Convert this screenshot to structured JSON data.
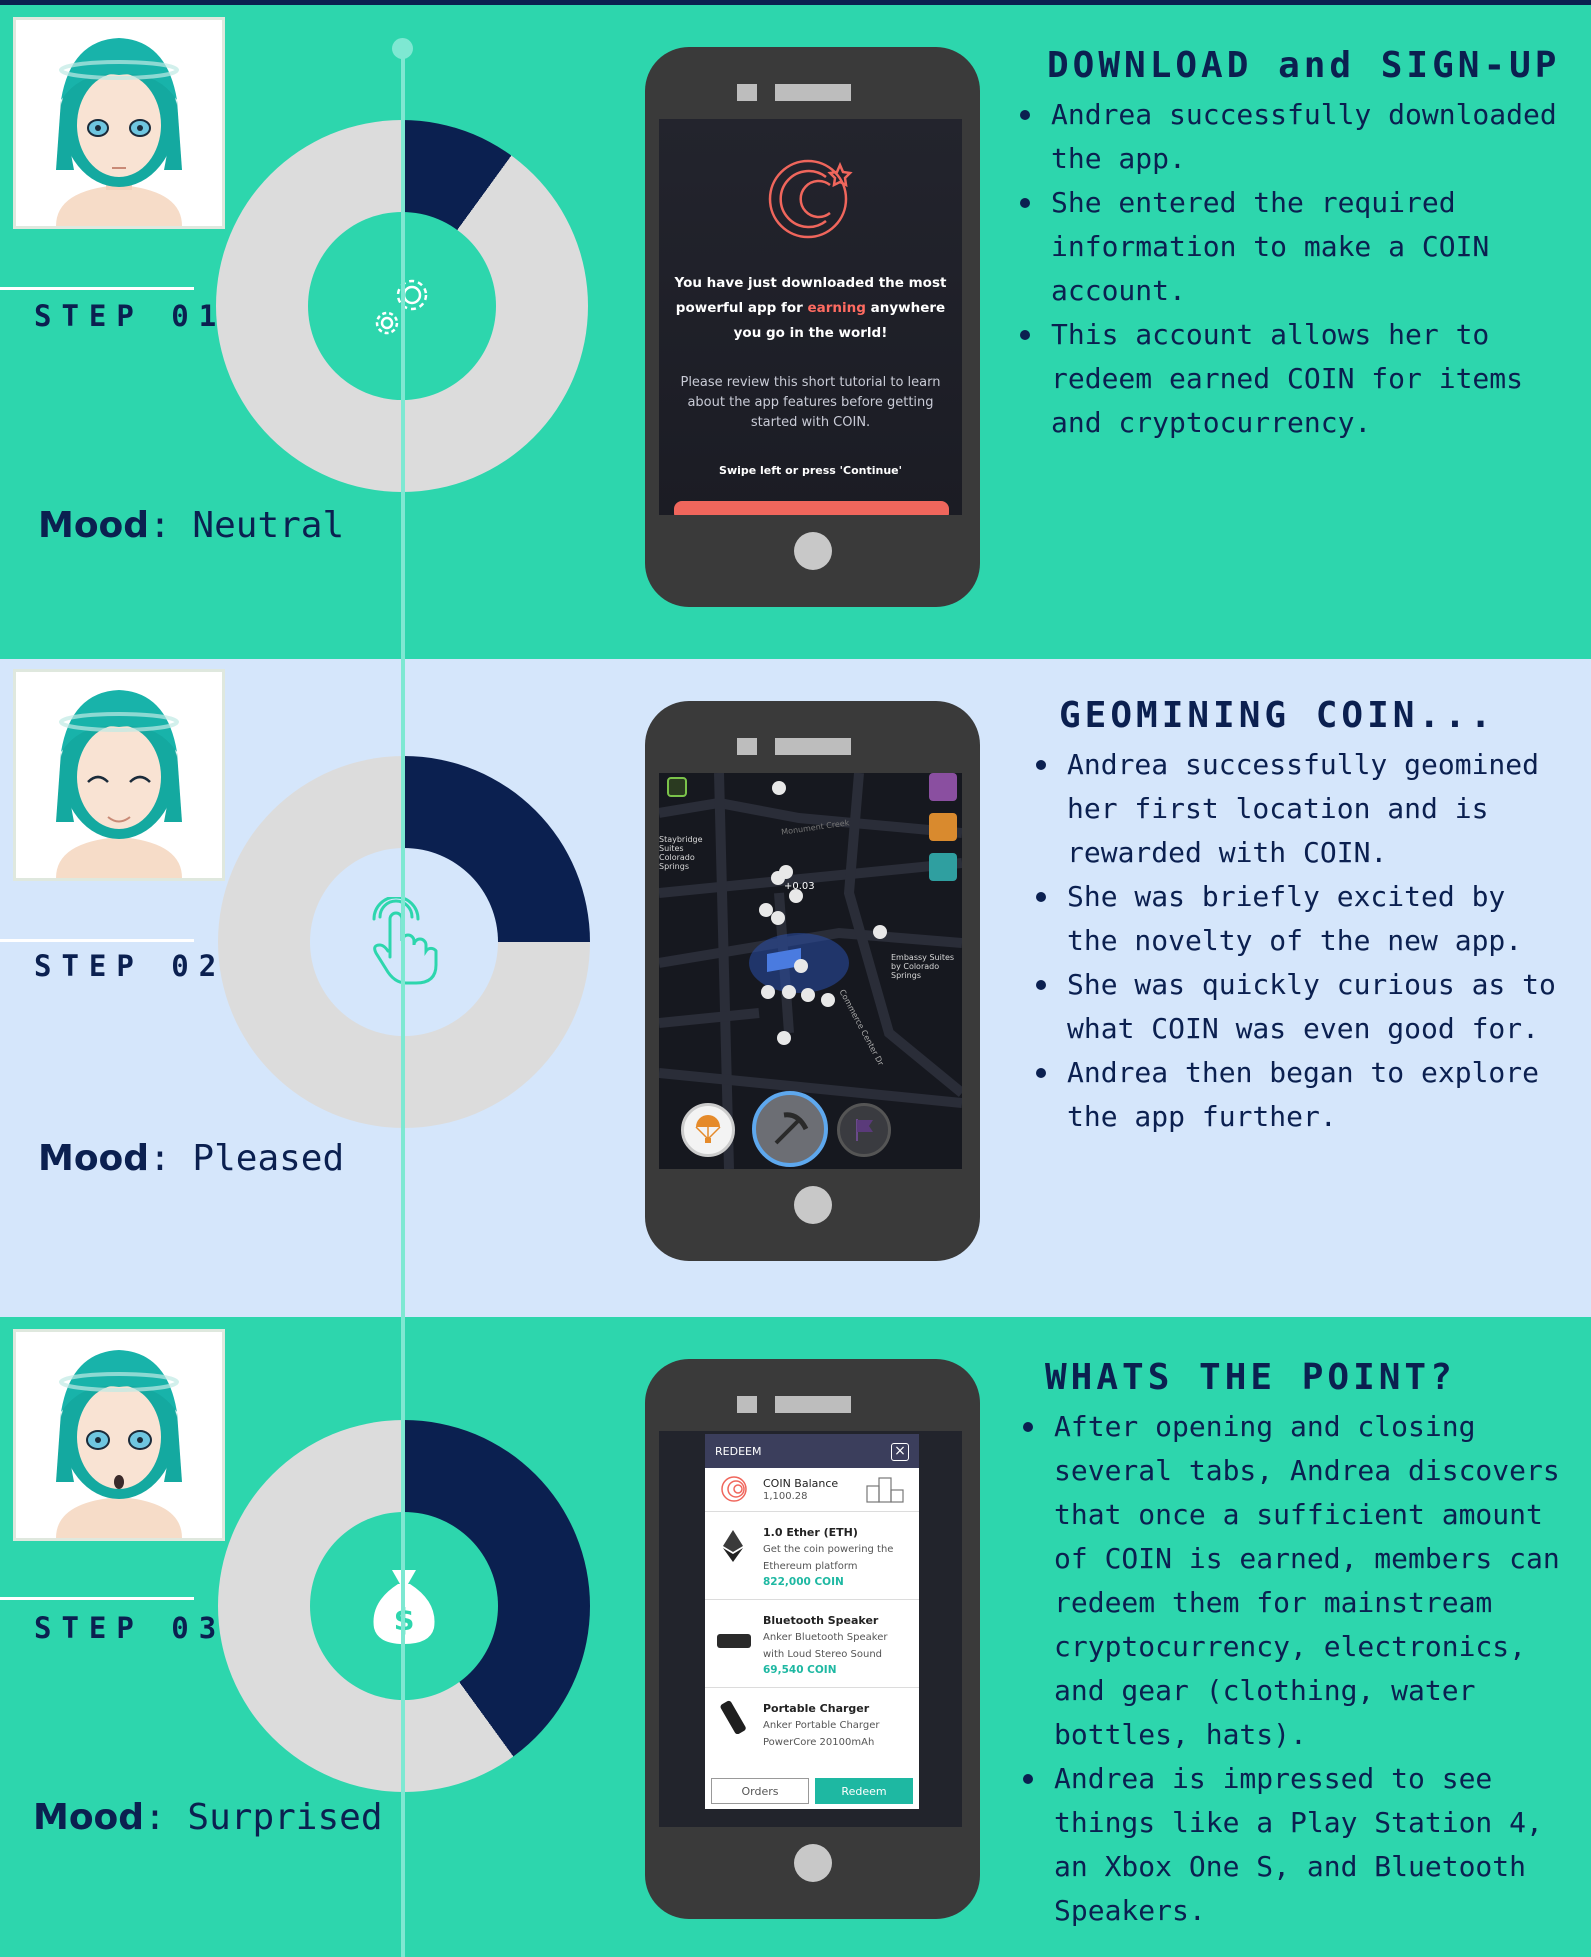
{
  "colors": {
    "navy": "#0b2050",
    "teal": "#2dd6ad",
    "light_blue": "#d5e6fb",
    "ring_grey": "#dcdcdc",
    "accent_red": "#ff6b61"
  },
  "steps": [
    {
      "step_label": "STEP 01",
      "mood_label": "Mood",
      "mood_value": "Neutral",
      "progress_fraction": 0.1,
      "icon": "gears-icon",
      "heading": "DOWNLOAD and SIGN-UP",
      "bullets": [
        "Andrea successfully downloaded the app.",
        "She entered the required information to make a COIN account.",
        "This account allows her to redeem earned COIN for items and cryptocurrency."
      ],
      "screen": {
        "main_pre": "You have just downloaded the most powerful app for",
        "main_highlight": "earning",
        "main_post": "anywhere you go in the world!",
        "sub": "Please review this short tutorial to learn about the app features before getting started with COIN.",
        "swipe": "Swipe left or press 'Continue'"
      }
    },
    {
      "step_label": "STEP 02",
      "mood_label": "Mood",
      "mood_value": "Pleased",
      "progress_fraction": 0.25,
      "icon": "tap-hand-icon",
      "heading": "GEOMINING COIN...",
      "bullets": [
        "Andrea successfully geomined her first location and is rewarded with COIN.",
        "She was briefly excited by the novelty of the new app.",
        "She was quickly curious as to what COIN was even good for.",
        "Andrea then began to explore the app further."
      ],
      "screen": {
        "reward": "+0.03",
        "labels": [
          "Monument Creek",
          "Staybridge Suites Colorado Springs",
          "Embassy Suites by Colorado Springs",
          "Commerce Center Dr"
        ]
      }
    },
    {
      "step_label": "STEP 03",
      "mood_label": "Mood",
      "mood_value": "Surprised",
      "progress_fraction": 0.4,
      "icon": "money-bag-icon",
      "heading": "WHATS THE POINT?",
      "bullets": [
        "After opening and closing several tabs, Andrea discovers that once a sufficient amount of COIN is earned, members can redeem them for mainstream cryptocurrency, electronics, and gear (clothing, water bottles, hats).",
        "Andrea is impressed to see things like a Play Station 4, an Xbox One S, and Bluetooth Speakers."
      ],
      "screen": {
        "title": "REDEEM",
        "close": "×",
        "balance_label": "COIN Balance",
        "balance_value": "1,100.28",
        "items": [
          {
            "title": "1.0 Ether (ETH)",
            "desc1": "Get the coin powering the",
            "desc2": "Ethereum platform",
            "price": "822,000 COIN"
          },
          {
            "title": "Bluetooth Speaker",
            "desc1": "Anker Bluetooth Speaker",
            "desc2": "with Loud Stereo Sound",
            "price": "69,540 COIN"
          },
          {
            "title": "Portable Charger",
            "desc1": "Anker Portable Charger",
            "desc2": "PowerCore 20100mAh",
            "price": ""
          }
        ],
        "orders_label": "Orders",
        "redeem_label": "Redeem"
      }
    }
  ]
}
